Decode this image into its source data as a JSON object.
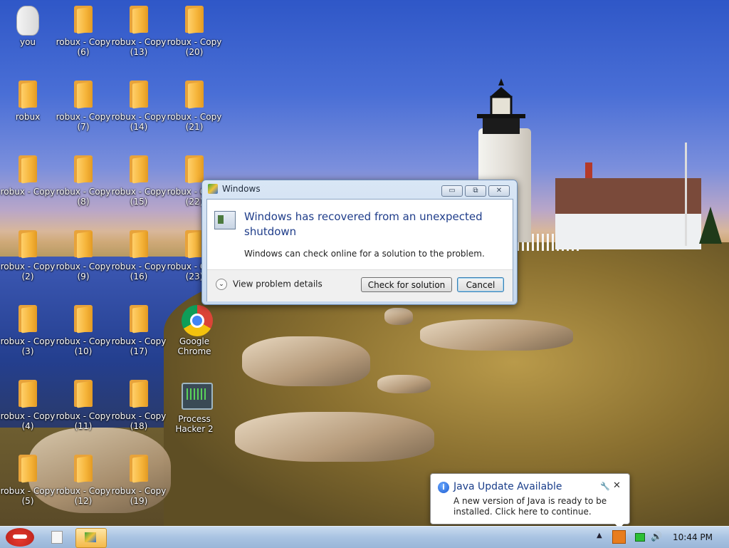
{
  "desktop": {
    "icons": [
      {
        "label": "you"
      },
      {
        "label": "robux - Copy (6)"
      },
      {
        "label": "robux - Copy (13)"
      },
      {
        "label": "robux - Copy (20)"
      },
      {
        "label": "robux"
      },
      {
        "label": "robux - Copy (7)"
      },
      {
        "label": "robux - Copy (14)"
      },
      {
        "label": "robux - Copy (21)"
      },
      {
        "label": "robux - Copy"
      },
      {
        "label": "robux - Copy (8)"
      },
      {
        "label": "robux - Copy (15)"
      },
      {
        "label": "robux - Copy (22)"
      },
      {
        "label": "robux - Copy (2)"
      },
      {
        "label": "robux - Copy (9)"
      },
      {
        "label": "robux - Copy (16)"
      },
      {
        "label": "robux - Copy (23)"
      },
      {
        "label": "robux - Copy (3)"
      },
      {
        "label": "robux - Copy (10)"
      },
      {
        "label": "robux - Copy (17)"
      },
      {
        "label": "Google Chrome"
      },
      {
        "label": "robux - Copy (4)"
      },
      {
        "label": "robux - Copy (11)"
      },
      {
        "label": "robux - Copy (18)"
      },
      {
        "label": "Process Hacker 2"
      },
      {
        "label": "robux - Copy (5)"
      },
      {
        "label": "robux - Copy (12)"
      },
      {
        "label": "robux - Copy (19)"
      }
    ]
  },
  "dialog": {
    "title": "Windows",
    "heading": "Windows has recovered from an unexpected shutdown",
    "subtext": "Windows can check online for a solution to the problem.",
    "details_label": "View problem details",
    "check_button": "Check for solution",
    "cancel_button": "Cancel",
    "caption_minimize": "▭",
    "caption_restore": "⧉",
    "caption_close": "✕"
  },
  "balloon": {
    "title": "Java Update Available",
    "text": "A new version of Java is ready to be installed. Click here to continue.",
    "info_glyph": "i",
    "close_glyph": "✕",
    "tool_glyph": "🔧"
  },
  "taskbar": {
    "tray_up": "▲",
    "volume": "🔊",
    "clock": "10:44 PM"
  }
}
